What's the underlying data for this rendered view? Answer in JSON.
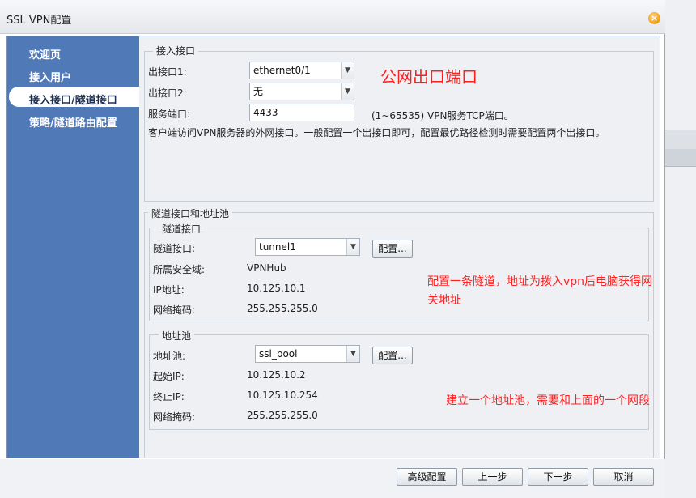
{
  "window": {
    "title": "SSL VPN配置",
    "close_glyph": "×"
  },
  "sidebar": {
    "items": [
      {
        "label": "欢迎页"
      },
      {
        "label": "接入用户"
      },
      {
        "label": "接入接口/隧道接口",
        "active": true
      },
      {
        "label": "策略/隧道路由配置"
      }
    ]
  },
  "access_interface": {
    "legend": "接入接口",
    "out_if1_label": "出接口1:",
    "out_if1_value": "ethernet0/1",
    "out_if2_label": "出接口2:",
    "out_if2_value": "无",
    "service_port_label": "服务端口:",
    "service_port_value": "4433",
    "service_port_hint": "(1~65535) VPN服务TCP端口。",
    "description": "客户端访问VPN服务器的外网接口。一般配置一个出接口即可，配置最优路径检测时需要配置两个出接口。"
  },
  "tunnel_section": {
    "legend": "隧道接口和地址池",
    "tunnel": {
      "legend": "隧道接口",
      "interface_label": "隧道接口:",
      "interface_value": "tunnel1",
      "config_button": "配置...",
      "zone_label": "所属安全域:",
      "zone_value": "VPNHub",
      "ip_label": "IP地址:",
      "ip_value": "10.125.10.1",
      "mask_label": "网络掩码:",
      "mask_value": "255.255.255.0"
    },
    "pool": {
      "legend": "地址池",
      "pool_label": "地址池:",
      "pool_value": "ssl_pool",
      "config_button": "配置...",
      "start_label": "起始IP:",
      "start_value": "10.125.10.2",
      "end_label": "终止IP:",
      "end_value": "10.125.10.254",
      "mask_label": "网络掩码:",
      "mask_value": "255.255.255.0"
    }
  },
  "annotations": {
    "public_port": "公网出口端口",
    "tunnel_note_line1": "配置一条隧道，地址为拨入vpn后电脑获得网",
    "tunnel_note_line2": "关地址",
    "pool_note": "建立一个地址池，需要和上面的一个网段",
    "color": "#ff2020"
  },
  "footer": {
    "advanced": "高级配置",
    "prev": "上一步",
    "next": "下一步",
    "cancel": "取消"
  },
  "colors": {
    "sidebar": "#5079b8",
    "content_bg": "#eef0f3",
    "frame_border": "#7d94b5"
  },
  "icons": {
    "dropdown": "chevron-down-icon",
    "close": "close-icon"
  }
}
